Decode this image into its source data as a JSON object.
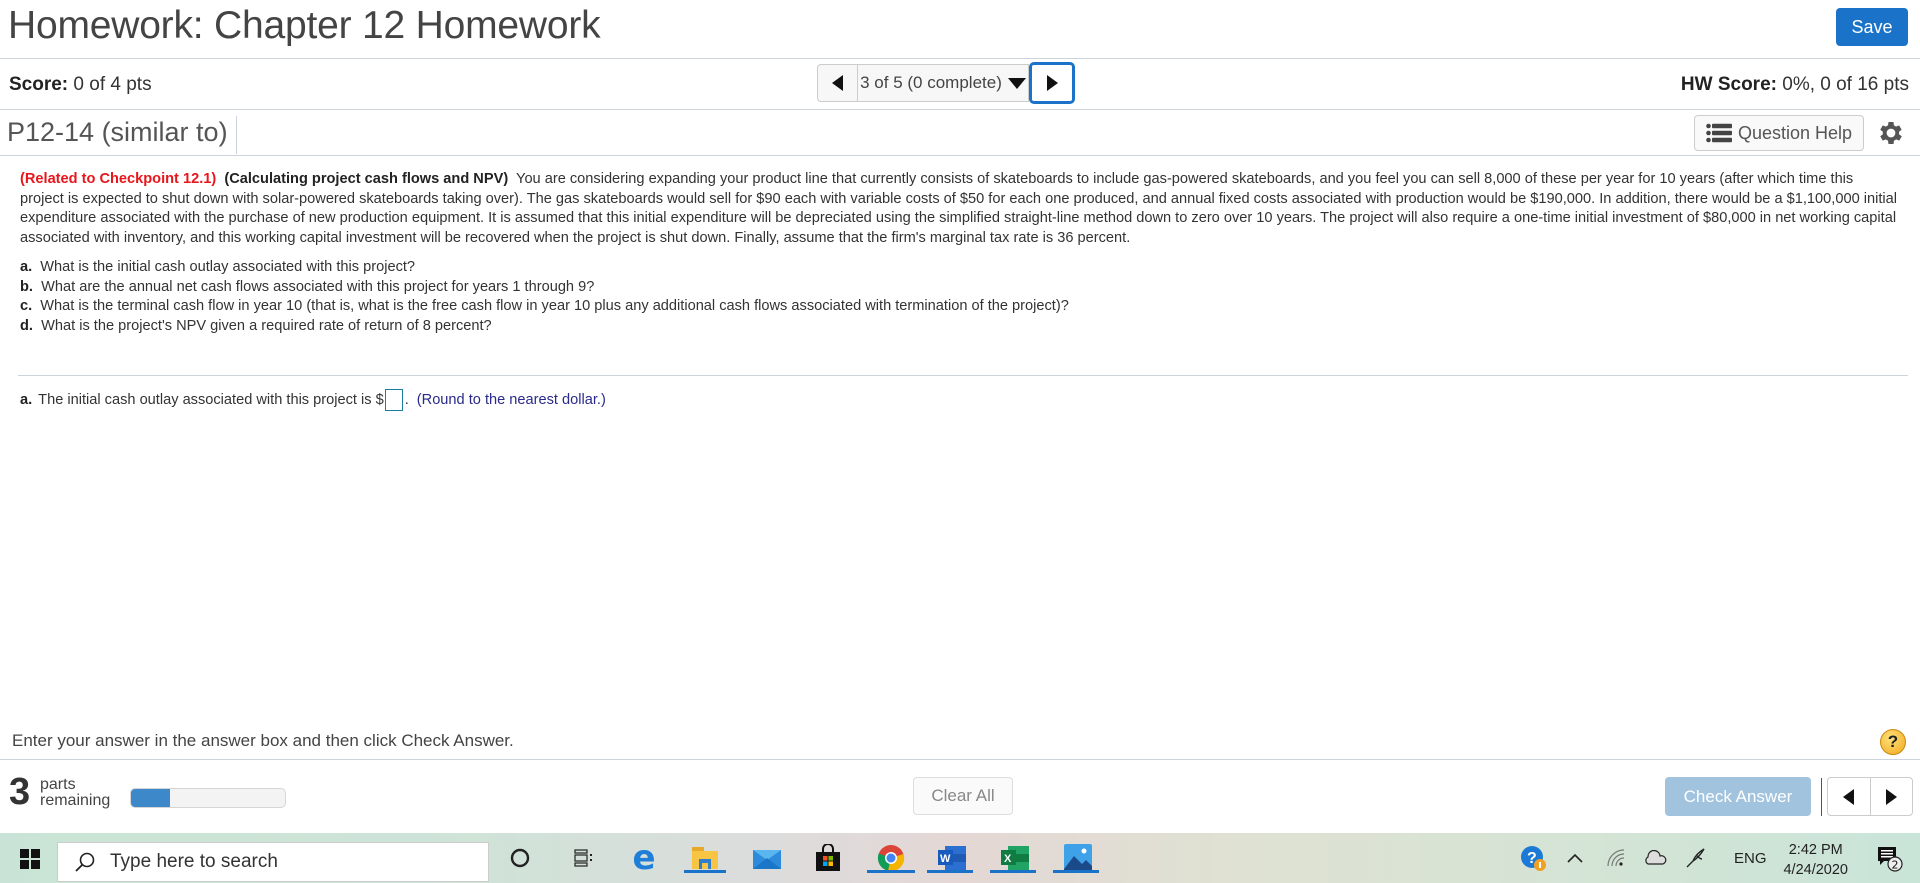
{
  "header": {
    "title": "Homework: Chapter 12 Homework",
    "save_label": "Save"
  },
  "scorebar": {
    "score_label": "Score:",
    "score_value": "0 of 4 pts",
    "question_selector": "3 of 5 (0 complete)",
    "hw_score_label": "HW Score:",
    "hw_score_value": "0%, 0 of 16 pts"
  },
  "question_bar": {
    "question_id": "P12-14 (similar to)",
    "help_label": "Question Help"
  },
  "problem": {
    "related": "(Related to Checkpoint 12.1)",
    "topic": "(Calculating project cash flows and NPV)",
    "body": "You are considering expanding your product line that currently consists of skateboards to include gas-powered skateboards, and you feel you can sell 8,000 of these per year for 10 years (after which time this project is expected to shut down with solar-powered skateboards taking over).  The gas skateboards would sell for $90 each with variable costs of $50 for each one produced, and annual fixed costs associated with production would be $190,000.  In addition, there would be a $1,100,000 initial expenditure associated with the purchase of new production equipment.  It is assumed that this initial expenditure will be depreciated using the simplified straight-line method down to zero over 10 years. The project will also require a one-time initial investment of $80,000 in net working capital associated with inventory, and this working capital investment will be recovered when the project is shut down.  Finally, assume that the firm's marginal tax rate is 36 percent.",
    "questions": [
      {
        "letter": "a.",
        "text": "What is the initial cash outlay associated with this project?"
      },
      {
        "letter": "b.",
        "text": "What are the annual net cash flows associated with this project for years 1 through 9?"
      },
      {
        "letter": "c.",
        "text": "What is the terminal cash flow in year 10 (that is, what is the free cash flow in year 10 plus any additional cash flows associated with termination of the project)?"
      },
      {
        "letter": "d.",
        "text": "What is the project's NPV given a required rate of return of 8 percent?"
      }
    ]
  },
  "answer": {
    "letter": "a.",
    "prompt": "The initial cash outlay associated with this project is $",
    "value": "",
    "suffix": ".",
    "hint": "(Round to the nearest dollar.)"
  },
  "footer": {
    "instruction": "Enter your answer in the answer box and then click Check Answer.",
    "parts_count": "3",
    "parts_label_1": "parts",
    "parts_label_2": "remaining",
    "progress_fraction": 0.25,
    "clear_label": "Clear All",
    "check_label": "Check Answer"
  },
  "taskbar": {
    "search_placeholder": "Type here to search",
    "apps": [
      "cortana",
      "task-view",
      "edge",
      "file-explorer",
      "mail",
      "store",
      "chrome",
      "word",
      "excel",
      "photos"
    ],
    "language": "ENG",
    "time": "2:42 PM",
    "date": "4/24/2020",
    "notification_count": "2"
  },
  "colors": {
    "accent": "#1a73c9",
    "related_red": "#e8151b",
    "hint_blue": "#2a2a8c",
    "check_disabled": "#a1c3de",
    "progress_fill": "#3d88c9"
  }
}
